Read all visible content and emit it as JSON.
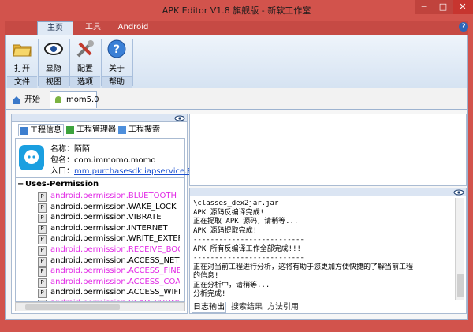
{
  "window": {
    "title": "APK Editor V1.8 旗舰版 - 新软工作室"
  },
  "ribbon": {
    "tabs": [
      "主页",
      "工具",
      "Android"
    ],
    "help": "?",
    "buttons": {
      "open": "打开",
      "toggle": "显隐",
      "config": "配置",
      "about": "关于"
    },
    "groups": {
      "file": "文件",
      "view": "视图",
      "options": "选项",
      "help": "帮助"
    }
  },
  "doc_tabs": {
    "start": "开始",
    "current": "mom5.0"
  },
  "project": {
    "tabs": {
      "info": "工程信息",
      "manager": "工程管理器",
      "search": "工程搜索"
    },
    "info": {
      "name_label": "名称：",
      "name": "陌陌",
      "package_label": "包名：",
      "package": "com.immomo.momo",
      "entry_label": "入口：",
      "entry": "mm.purchasesdk.iapservice.P..."
    },
    "permissions_header": "Uses-Permission",
    "permissions": [
      {
        "text": "android.permission.BLUETOOTH",
        "highlight": true
      },
      {
        "text": "android.permission.WAKE_LOCK",
        "highlight": false
      },
      {
        "text": "android.permission.VIBRATE",
        "highlight": false
      },
      {
        "text": "android.permission.INTERNET",
        "highlight": false
      },
      {
        "text": "android.permission.WRITE_EXTERN",
        "highlight": false
      },
      {
        "text": "android.permission.RECEIVE_BOO",
        "highlight": true
      },
      {
        "text": "android.permission.ACCESS_NETW",
        "highlight": false
      },
      {
        "text": "android.permission.ACCESS_FINE_",
        "highlight": true
      },
      {
        "text": "android.permission.ACCESS_COAR",
        "highlight": true
      },
      {
        "text": "android.permission.ACCESS_WIFI_",
        "highlight": false
      },
      {
        "text": "android.permission.READ_PHONE",
        "highlight": true
      }
    ]
  },
  "colors": {
    "highlight": "#e22be6",
    "ribbon_bg": "#d6e3f2",
    "frame": "#d2534c"
  },
  "log": {
    "lines": [
      "\\classes_dex2jar.jar",
      "APK 源码反编译完成!",
      "正在提取 APK 源码，请稍等...",
      "APK 源码提取完成!",
      "--------------------------",
      "APK 所有反编译工作全部完成!!!",
      "--------------------------",
      "正在对当前工程进行分析，这将有助于您更加方便快捷的了解当前工程",
      "的信息!",
      "正在分析中，请稍等...",
      "分析完成!"
    ],
    "tabs": {
      "output": "日志输出",
      "search": "搜索结果",
      "method": "方法引用"
    }
  }
}
